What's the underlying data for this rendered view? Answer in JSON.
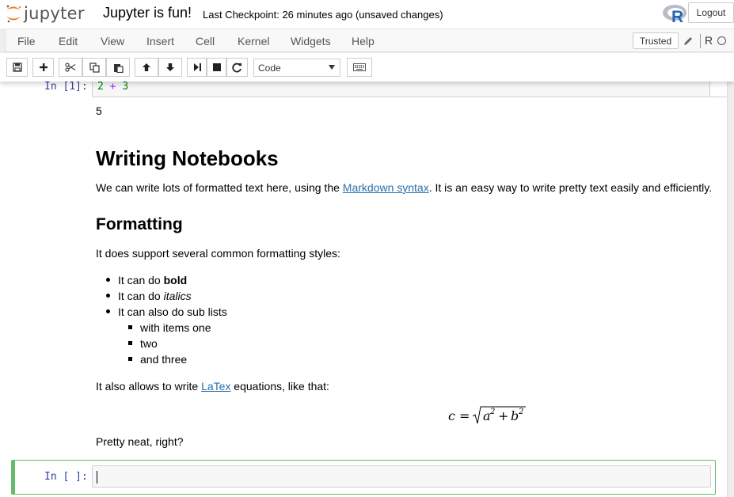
{
  "header": {
    "logo_text": "jupyter",
    "notebook_title": "Jupyter is fun!",
    "checkpoint": "Last Checkpoint: 26 minutes ago (unsaved changes)",
    "logout_label": "Logout"
  },
  "menubar": {
    "items": [
      "File",
      "Edit",
      "View",
      "Insert",
      "Cell",
      "Kernel",
      "Widgets",
      "Help"
    ],
    "trusted_label": "Trusted",
    "kernel_name": "R"
  },
  "toolbar": {
    "cell_type": "Code",
    "buttons": [
      "save-icon",
      "plus-icon",
      "cut-icon",
      "copy-icon",
      "paste-icon",
      "arrow-up-icon",
      "arrow-down-icon",
      "run-icon",
      "stop-icon",
      "restart-icon",
      "keyboard-icon"
    ]
  },
  "cells": {
    "code1": {
      "prompt": "In [1]:",
      "code_a": "2",
      "code_op": "+",
      "code_b": "3",
      "output": "5"
    },
    "markdown": {
      "h1": "Writing Notebooks",
      "p1_before": "We can write lots of formatted text here, using the ",
      "p1_link": "Markdown syntax",
      "p1_after": ". It is an easy way to write pretty text easily and efficiently.",
      "h2": "Formatting",
      "p2": "It does support several common formatting styles:",
      "li1_prefix": "It can do ",
      "li1_bold": "bold",
      "li2_prefix": "It can do ",
      "li2_italic": "italics",
      "li3": "It can also do sub lists",
      "sub1": "with items one",
      "sub2": "two",
      "sub3": "and three",
      "p3_before": "It also allows to write ",
      "p3_link": "LaTex",
      "p3_after": " equations, like that:",
      "equation": "c = √(a² + b²)",
      "p4": "Pretty neat, right?"
    },
    "code2": {
      "prompt": "In [ ]:"
    }
  },
  "colors": {
    "selected_border": "#66bb6a",
    "prompt": "#303f9f",
    "link": "#296eaa",
    "number": "#008000",
    "operator": "#aa22ff"
  }
}
